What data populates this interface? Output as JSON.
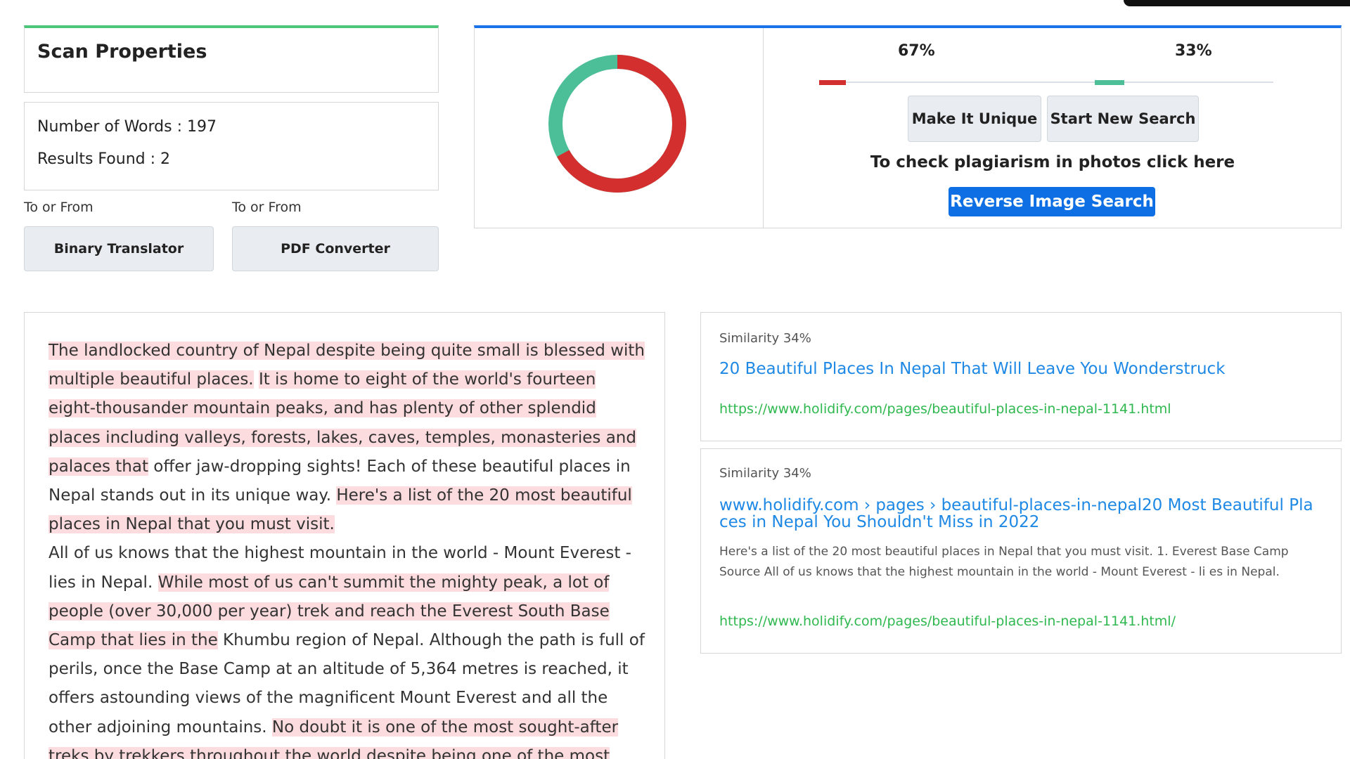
{
  "scan": {
    "title": "Scan Properties",
    "words": "Number of Words : 197",
    "results": "Results Found : 2"
  },
  "tools": [
    {
      "label": "To or From",
      "button": "Binary Translator"
    },
    {
      "label": "To or From",
      "button": "PDF Converter"
    }
  ],
  "chart": {
    "plagiarized_pct": "67%",
    "unique_pct": "33%",
    "plagiarized_value": 67,
    "unique_value": 33,
    "colors": {
      "plagiarized": "#d32f2f",
      "unique": "#4cbf98"
    }
  },
  "actions": {
    "make_unique": "Make It Unique",
    "new_search": "Start New Search",
    "photo_text": "To check plagiarism in photos click here",
    "reverse_image": "Reverse Image Search"
  },
  "content": [
    {
      "t": "The landlocked country of Nepal despite being quite small is blessed with multiple beautiful places.",
      "h": true
    },
    {
      "t": " ",
      "h": false
    },
    {
      "t": "It is home to eight of the world's fourteen eight-thousander mountain peaks, and has plenty of other splendid places including valleys, forests, lakes, caves, temples, monasteries and palaces that",
      "h": true
    },
    {
      "t": " offer jaw-dropping sights! Each of these beautiful places in Nepal stands out in its unique way. ",
      "h": false
    },
    {
      "t": "Here's a list of the 20 most beautiful places in Nepal that you must visit.",
      "h": true
    },
    {
      "t": "All of us knows that the highest mountain in the world - Mount Everest - lies in Nepal. ",
      "h": false
    },
    {
      "t": "While most of us can't summit the mighty peak, a lot of people (over 30,000 per year) trek and reach the Everest South Base Camp that lies in the",
      "h": true
    },
    {
      "t": " Khumbu region of Nepal. Although the path is full of perils, once the Base Camp at an altitude of 5,364 metres is reached, it offers astounding views of the magnificent Mount Everest and all the other adjoining mountains. ",
      "h": false
    },
    {
      "t": "No doubt it is one of the most sought-after treks by trekkers throughout the world despite being one of the most",
      "h": true
    }
  ],
  "results": [
    {
      "similarity": "Similarity 34%",
      "title": "20 Beautiful Places In Nepal That Will Leave You Wonderstruck",
      "url": "https://www.holidify.com/pages/beautiful-places-in-nepal-1141.html"
    },
    {
      "similarity": "Similarity 34%",
      "title": "www.holidify.com › pages › beautiful-places-in-nepal20 Most Beautiful Pla ces in Nepal You Shouldn't Miss in 2022",
      "snippet": "Here's a list of the 20 most beautiful places in Nepal that you must visit. 1. Everest Base Camp Source All of us knows that the highest mountain in the world - Mount Everest - li es in Nepal.",
      "url": "https://www.holidify.com/pages/beautiful-places-in-nepal-1141.html/"
    }
  ]
}
